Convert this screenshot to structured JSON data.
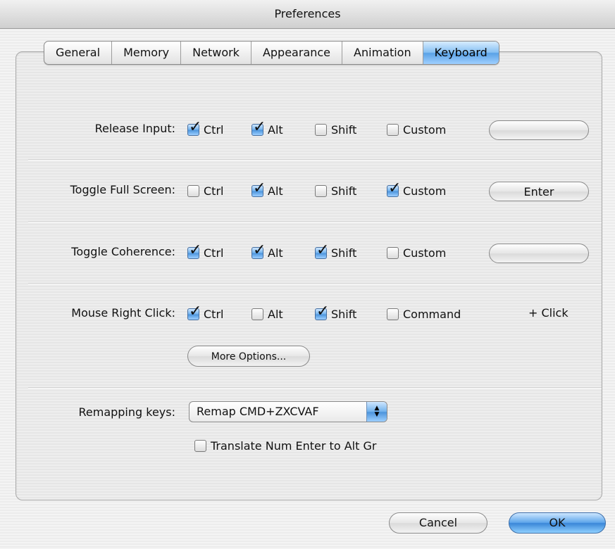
{
  "window": {
    "title": "Preferences"
  },
  "tabs": [
    {
      "label": "General",
      "selected": false
    },
    {
      "label": "Memory",
      "selected": false
    },
    {
      "label": "Network",
      "selected": false
    },
    {
      "label": "Appearance",
      "selected": false
    },
    {
      "label": "Animation",
      "selected": false
    },
    {
      "label": "Keyboard",
      "selected": true
    }
  ],
  "shortcuts": {
    "release_input": {
      "label": "Release Input:",
      "ctrl": {
        "label": "Ctrl",
        "checked": true
      },
      "alt": {
        "label": "Alt",
        "checked": true
      },
      "shift": {
        "label": "Shift",
        "checked": false
      },
      "custom": {
        "label": "Custom",
        "checked": false
      },
      "key": ""
    },
    "toggle_full_screen": {
      "label": "Toggle Full Screen:",
      "ctrl": {
        "label": "Ctrl",
        "checked": false
      },
      "alt": {
        "label": "Alt",
        "checked": true
      },
      "shift": {
        "label": "Shift",
        "checked": false
      },
      "custom": {
        "label": "Custom",
        "checked": true
      },
      "key": "Enter"
    },
    "toggle_coherence": {
      "label": "Toggle Coherence:",
      "ctrl": {
        "label": "Ctrl",
        "checked": true
      },
      "alt": {
        "label": "Alt",
        "checked": true
      },
      "shift": {
        "label": "Shift",
        "checked": true
      },
      "custom": {
        "label": "Custom",
        "checked": false
      },
      "key": ""
    },
    "mouse_right_click": {
      "label": "Mouse Right Click:",
      "ctrl": {
        "label": "Ctrl",
        "checked": true
      },
      "alt": {
        "label": "Alt",
        "checked": false
      },
      "shift": {
        "label": "Shift",
        "checked": true
      },
      "command": {
        "label": "Command",
        "checked": false
      },
      "suffix": "+ Click",
      "more_options_label": "More Options..."
    }
  },
  "remapping": {
    "label": "Remapping keys:",
    "selected": "Remap CMD+ZXCVAF",
    "translate_num_enter": {
      "label": "Translate Num Enter to Alt Gr",
      "checked": false
    }
  },
  "buttons": {
    "cancel_label": "Cancel",
    "ok_label": "OK"
  },
  "colors": {
    "accent": "#5aa2e6"
  }
}
